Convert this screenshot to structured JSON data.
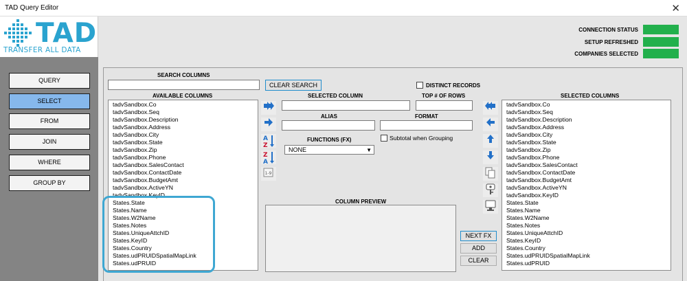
{
  "window": {
    "title": "TAD Query Editor",
    "close_glyph": "✕"
  },
  "logo": {
    "mark": "TAD",
    "tagline": "TRANSFER ALL DATA",
    "icon": "grid-diamond-icon"
  },
  "nav": [
    {
      "label": "QUERY"
    },
    {
      "label": "SELECT",
      "active": true
    },
    {
      "label": "FROM"
    },
    {
      "label": "JOIN"
    },
    {
      "label": "WHERE"
    },
    {
      "label": "GROUP BY"
    }
  ],
  "status": {
    "connection": "CONNECTION STATUS",
    "setup": "SETUP REFRESHED",
    "companies": "COMPANIES SELECTED",
    "indicator_color": "#22b04c"
  },
  "search": {
    "label": "SEARCH COLUMNS",
    "value": "",
    "clear_label": "CLEAR SEARCH"
  },
  "distinct": {
    "label": "DISTINCT RECORDS",
    "checked": false
  },
  "available": {
    "header": "AVAILABLE COLUMNS",
    "items": [
      "tadvSandbox.Co",
      "tadvSandbox.Seq",
      "tadvSandbox.Description",
      "tadvSandbox.Address",
      "tadvSandbox.City",
      "tadvSandbox.State",
      "tadvSandbox.Zip",
      "tadvSandbox.Phone",
      "tadvSandbox.SalesContact",
      "tadvSandbox.ContactDate",
      "tadvSandbox.BudgetAmt",
      "tadvSandbox.ActiveYN",
      "tadvSandbox.KeyID",
      "States.State",
      "States.Name",
      "States.W2Name",
      "States.Notes",
      "States.UniqueAttchID",
      "States.KeyID",
      "States.Country",
      "States.udPRUIDSpatialMapLink",
      "States.udPRUID"
    ]
  },
  "selected_column": {
    "label": "SELECTED COLUMN",
    "value": ""
  },
  "top_rows": {
    "label": "TOP # OF ROWS",
    "value": ""
  },
  "alias": {
    "label": "ALIAS",
    "value": ""
  },
  "format": {
    "label": "FORMAT",
    "value": ""
  },
  "functions": {
    "label": "FUNCTIONS (FX)",
    "value": "NONE"
  },
  "subtotal": {
    "label": "Subtotal when Grouping",
    "checked": false
  },
  "preview": {
    "label": "COLUMN PREVIEW",
    "value": ""
  },
  "actions": {
    "next_fx": "NEXT FX",
    "add": "ADD",
    "clear": "CLEAR"
  },
  "selected": {
    "header": "SELECTED COLUMNS",
    "items": [
      "tadvSandbox.Co",
      "tadvSandbox.Seq",
      "tadvSandbox.Description",
      "tadvSandbox.Address",
      "tadvSandbox.City",
      "tadvSandbox.State",
      "tadvSandbox.Zip",
      "tadvSandbox.Phone",
      "tadvSandbox.SalesContact",
      "tadvSandbox.ContactDate",
      "tadvSandbox.BudgetAmt",
      "tadvSandbox.ActiveYN",
      "tadvSandbox.KeyID",
      "States.State",
      "States.Name",
      "States.W2Name",
      "States.Notes",
      "States.UniqueAttchID",
      "States.KeyID",
      "States.Country",
      "States.udPRUIDSpatialMapLink",
      "States.udPRUID"
    ]
  },
  "sort_icons": {
    "az": "A Z",
    "za": "Z A",
    "num": "1-9"
  }
}
